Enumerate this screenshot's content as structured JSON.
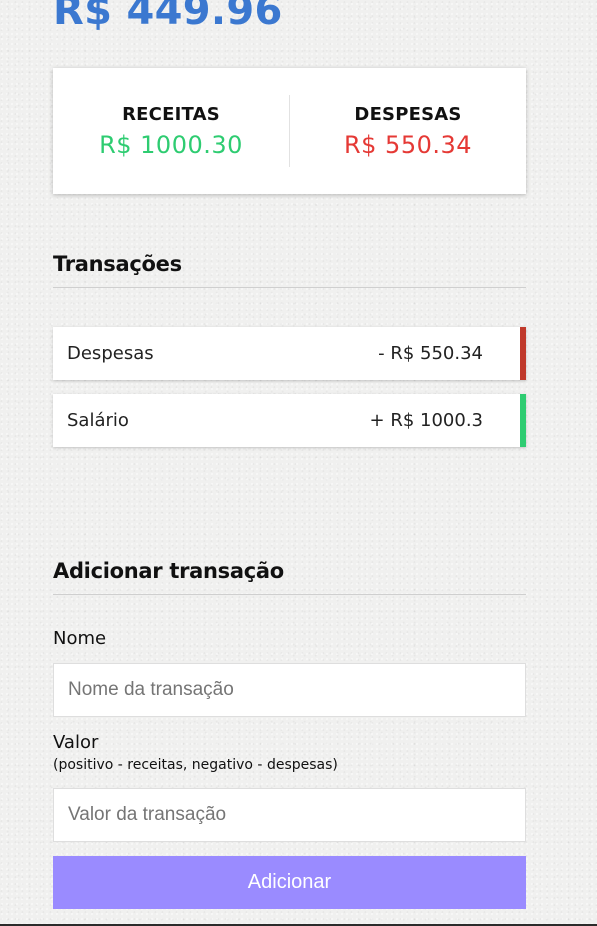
{
  "balance": {
    "value": "R$ 449.96",
    "color": "#3b78d0"
  },
  "summary": {
    "income_label": "RECEITAS",
    "income_value": "R$ 1000.30",
    "income_color": "#2ecc71",
    "expense_label": "DESPESAS",
    "expense_value": "R$ 550.34",
    "expense_color": "#e53935"
  },
  "transactions": {
    "title": "Transações",
    "items": [
      {
        "name": "Despesas",
        "amount": "- R$ 550.34",
        "type": "expense",
        "indicator_color": "#c0392b"
      },
      {
        "name": "Salário",
        "amount": "+ R$ 1000.3",
        "type": "income",
        "indicator_color": "#2ecc71"
      }
    ]
  },
  "form": {
    "title": "Adicionar transação",
    "name_label": "Nome",
    "name_placeholder": "Nome da transação",
    "value_label": "Valor",
    "value_hint": "(positivo - receitas, negativo - despesas)",
    "value_placeholder": "Valor da transação",
    "submit_label": "Adicionar",
    "submit_color": "#9a8bff"
  }
}
